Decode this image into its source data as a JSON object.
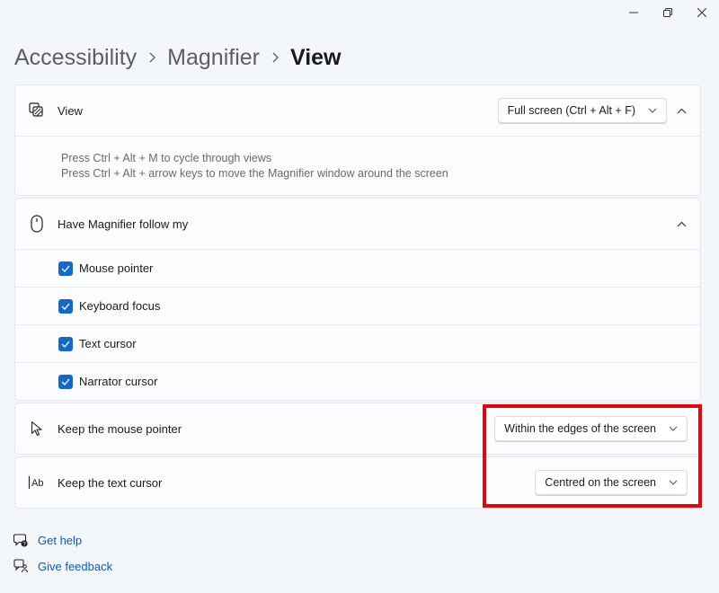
{
  "breadcrumb": {
    "items": [
      "Accessibility",
      "Magnifier"
    ],
    "current": "View"
  },
  "view_card": {
    "label": "View",
    "icon": "magnifier-view-icon",
    "dropdown_value": "Full screen (Ctrl + Alt + F)",
    "info_lines": [
      "Press Ctrl + Alt + M to cycle through views",
      "Press Ctrl + Alt + arrow keys to move the Magnifier window around the screen"
    ]
  },
  "follow_card": {
    "label": "Have Magnifier follow my",
    "icon": "mouse-icon",
    "options": [
      {
        "label": "Mouse pointer",
        "checked": true
      },
      {
        "label": "Keyboard focus",
        "checked": true
      },
      {
        "label": "Text cursor",
        "checked": true
      },
      {
        "label": "Narrator cursor",
        "checked": true
      }
    ]
  },
  "mouse_pointer_card": {
    "label": "Keep the mouse pointer",
    "icon": "mouse-pointer-icon",
    "dropdown_value": "Within the edges of the screen"
  },
  "text_cursor_card": {
    "label": "Keep the text cursor",
    "icon": "text-cursor-icon",
    "dropdown_value": "Centred on the screen"
  },
  "links": {
    "get_help": "Get help",
    "give_feedback": "Give feedback"
  },
  "colors": {
    "accent": "#1468c6",
    "link": "#0b5ab8",
    "highlight": "#e0080e",
    "background": "#f3f6fb"
  }
}
